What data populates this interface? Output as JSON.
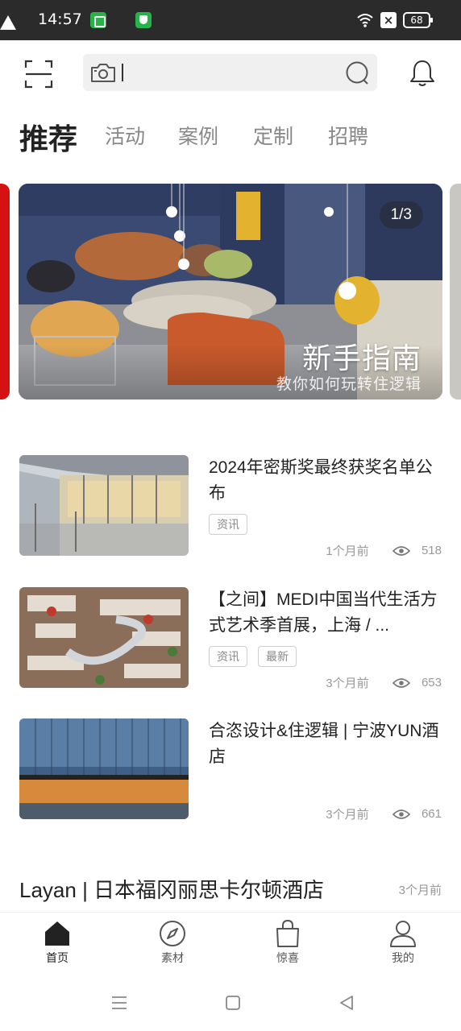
{
  "status_bar": {
    "time": "14:57",
    "battery": "68",
    "icons": [
      "green-app-icon",
      "warning-icon",
      "shield-app-icon",
      "wifi-icon",
      "no-sim-icon",
      "battery-icon"
    ]
  },
  "header": {
    "search": {
      "value": "",
      "placeholder": ""
    },
    "icons": [
      "scan-icon",
      "camera-icon",
      "search-icon",
      "bell-icon"
    ]
  },
  "tabs": [
    {
      "label": "推荐",
      "active": true
    },
    {
      "label": "活动",
      "active": false
    },
    {
      "label": "案例",
      "active": false
    },
    {
      "label": "定制",
      "active": false
    },
    {
      "label": "招聘",
      "active": false
    }
  ],
  "banner": {
    "counter": "1/3",
    "title": "新手指南",
    "subtitle": "教你如何玩转住逻辑"
  },
  "articles": [
    {
      "title": "2024年密斯奖最终获奖名单公布",
      "tags": [
        "资讯"
      ],
      "time": "1个月前",
      "views": "518"
    },
    {
      "title": "【之间】MEDI中国当代生活方式艺术季首展，上海 / ...",
      "tags": [
        "资讯",
        "最新"
      ],
      "time": "3个月前",
      "views": "653"
    },
    {
      "title": "合恣设计&住逻辑 | 宁波YUN酒店",
      "tags": [],
      "time": "3个月前",
      "views": "661"
    }
  ],
  "last_item": {
    "title": "Layan | 日本福冈丽思卡尔顿酒店",
    "time": "3个月前"
  },
  "bottom_nav": [
    {
      "label": "首页",
      "icon": "home-icon",
      "active": true
    },
    {
      "label": "素材",
      "icon": "compass-icon",
      "active": false
    },
    {
      "label": "惊喜",
      "icon": "shopping-bag-icon",
      "active": false
    },
    {
      "label": "我的",
      "icon": "person-icon",
      "active": false
    }
  ],
  "colors": {
    "accent": "#222222",
    "muted": "#888888",
    "status_bar_bg": "#2b2b2b",
    "search_bg": "#f0f0f0",
    "status_green": "#27b24a"
  }
}
